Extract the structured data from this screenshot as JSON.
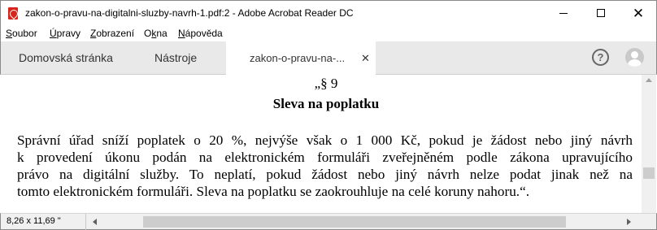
{
  "window": {
    "title": "zakon-o-pravu-na-digitalni-sluzby-navrh-1.pdf:2 - Adobe Acrobat Reader DC",
    "icon": "acrobat-pdf-icon"
  },
  "menu": {
    "items": [
      {
        "label": "Soubor",
        "accesskey": "S"
      },
      {
        "label": "Úpravy",
        "accesskey": "Ú"
      },
      {
        "label": "Zobrazení",
        "accesskey": "Z"
      },
      {
        "label": "Okna",
        "accesskey": "k"
      },
      {
        "label": "Nápověda",
        "accesskey": "N"
      }
    ]
  },
  "tabs": {
    "home": "Domovská stránka",
    "tools": "Nástroje",
    "document": "zakon-o-pravu-na-...",
    "close": "✕"
  },
  "document": {
    "section_number": "„§ 9",
    "section_title": "Sleva na poplatku",
    "lines": [
      "Správní úřad sníží poplatek o 20 %, nejvýše však o 1 000 Kč, pokud je žádost nebo jiný návrh",
      "k provedení úkonu podán na elektronickém formuláři zveřejněném podle zákona upravujícího",
      "právo na digitální služby. To neplatí, pokud žádost nebo jiný návrh nelze podat jinak než na",
      "tomto elektronickém formuláři. Sleva na poplatku se zaokrouhluje na celé koruny nahoru.“."
    ]
  },
  "status": {
    "page_size": "8,26 x 11,69 \""
  },
  "colors": {
    "acrobat_red": "#d8251b",
    "tab_bar": "#e9e9e9",
    "scrollbar": "#f0f0f0"
  }
}
